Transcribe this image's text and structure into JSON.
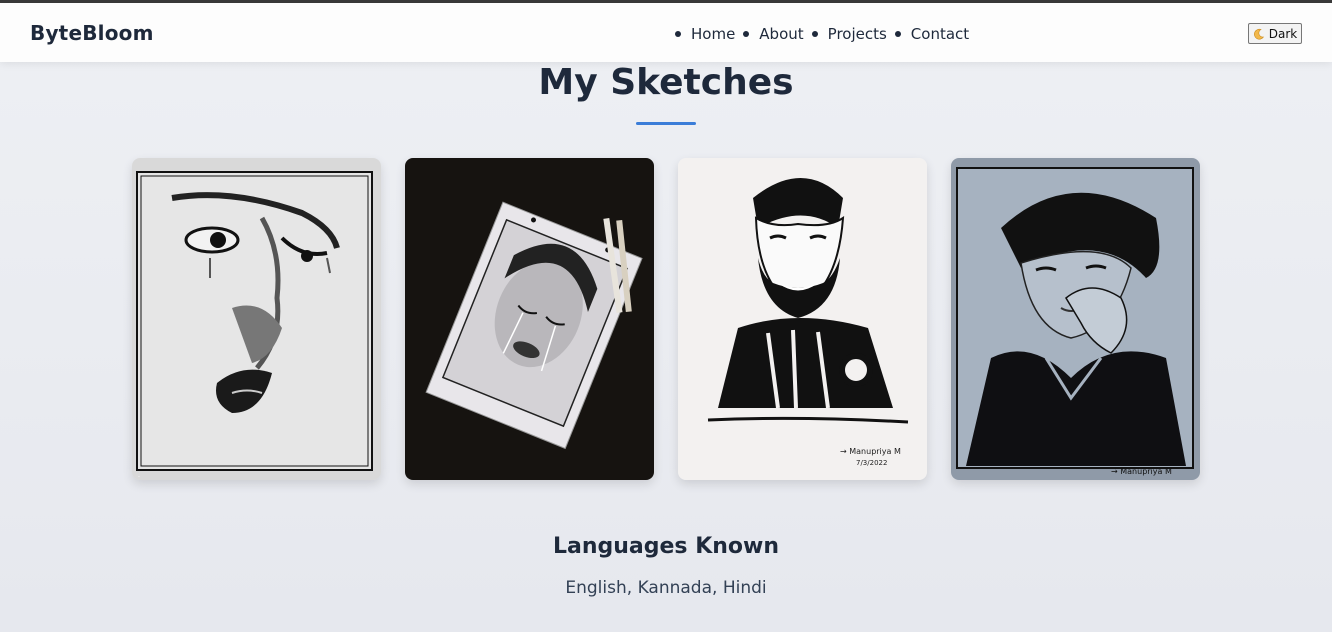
{
  "brand": "ByteBloom",
  "nav": {
    "items": [
      {
        "label": "Home"
      },
      {
        "label": "About"
      },
      {
        "label": "Projects"
      },
      {
        "label": "Contact"
      }
    ]
  },
  "theme_toggle": {
    "label": "Dark",
    "icon": "moon-icon"
  },
  "sketches": {
    "title": "My Sketches",
    "accent_color": "#3b7dd8",
    "images": [
      {
        "name": "sketch-face-tears"
      },
      {
        "name": "sketch-girl-crying-on-paper"
      },
      {
        "name": "sketch-bearded-man-ink",
        "signature": "→ Manupriya M\n7/3/2022"
      },
      {
        "name": "sketch-young-man-hand-chin",
        "signature": "→ Manupriya M"
      }
    ]
  },
  "languages": {
    "title": "Languages Known",
    "list": "English, Kannada, Hindi"
  }
}
